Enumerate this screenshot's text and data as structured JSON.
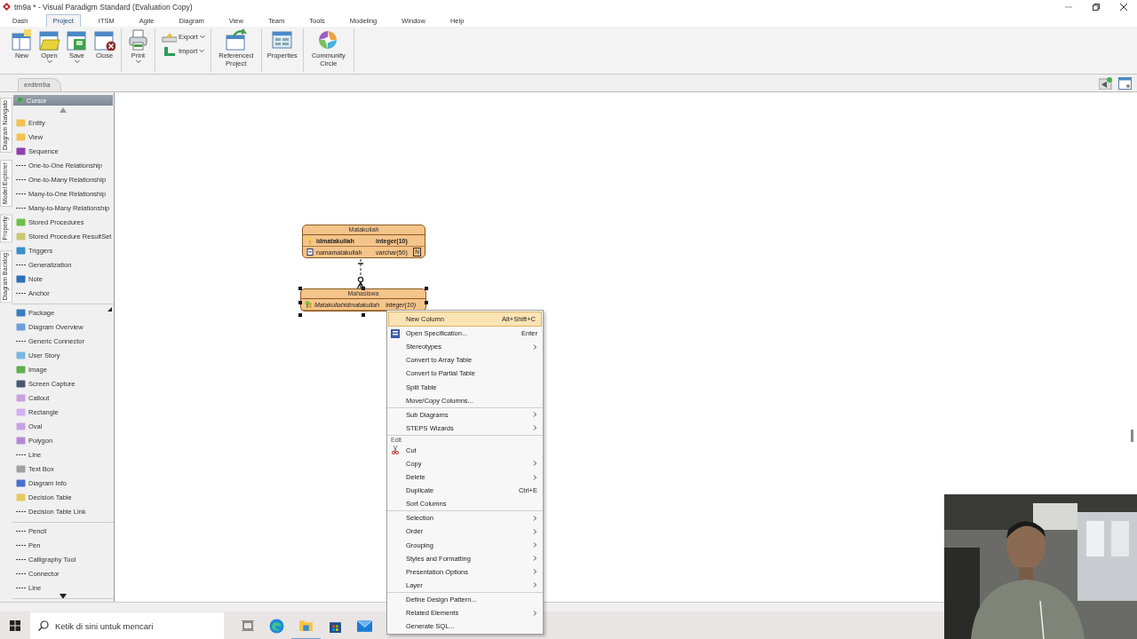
{
  "window": {
    "title": "tm9a * - Visual Paradigm Standard (Evaluation Copy)"
  },
  "menu_tabs": [
    {
      "label": "Dash",
      "selected": false
    },
    {
      "label": "Project",
      "selected": true
    },
    {
      "label": "ITSM",
      "selected": false
    },
    {
      "label": "Agile",
      "selected": false
    },
    {
      "label": "Diagram",
      "selected": false
    },
    {
      "label": "View",
      "selected": false
    },
    {
      "label": "Team",
      "selected": false
    },
    {
      "label": "Tools",
      "selected": false
    },
    {
      "label": "Modeling",
      "selected": false
    },
    {
      "label": "Window",
      "selected": false
    },
    {
      "label": "Help",
      "selected": false
    }
  ],
  "ribbon": [
    {
      "kind": "large",
      "buttons": [
        {
          "label": "New",
          "kind": "new",
          "dropdown": false
        },
        {
          "label": "Open",
          "kind": "open",
          "dropdown": true
        },
        {
          "label": "Save",
          "kind": "save",
          "dropdown": true
        },
        {
          "label": "Close",
          "kind": "close",
          "dropdown": false
        }
      ]
    },
    {
      "kind": "large",
      "buttons": [
        {
          "label": "Print",
          "kind": "print",
          "dropdown": true
        }
      ]
    },
    {
      "kind": "stacked",
      "buttons": [
        {
          "label": "Export",
          "kind": "export",
          "dropdown": true
        },
        {
          "label": "Import",
          "kind": "import",
          "dropdown": true
        }
      ]
    },
    {
      "kind": "large",
      "buttons": [
        {
          "label": "Referenced Project",
          "kind": "referenced",
          "dropdown": false
        }
      ]
    },
    {
      "kind": "large",
      "buttons": [
        {
          "label": "Properties",
          "kind": "properties",
          "dropdown": false
        }
      ]
    },
    {
      "kind": "large",
      "buttons": [
        {
          "label": "Community Circle",
          "kind": "community",
          "dropdown": false
        }
      ]
    }
  ],
  "diagram_tabs": [
    {
      "label": "erdtm9a",
      "selected": true
    }
  ],
  "side_tabs": [
    {
      "label": "Diagram Navigato"
    },
    {
      "label": "Model Explorer"
    },
    {
      "label": "Property"
    },
    {
      "label": "Diagram Backlog"
    }
  ],
  "palette": {
    "cursor": {
      "label": "Cursor",
      "selected": true
    },
    "sections": [
      {
        "items": [
          {
            "label": "Entity",
            "kind": "block",
            "color": "#f2c14e"
          },
          {
            "label": "View",
            "kind": "block",
            "color": "#f2c14e"
          },
          {
            "label": "Sequence",
            "kind": "block",
            "color": "#8e3fb0"
          },
          {
            "label": "One-to-One Relationship",
            "kind": "line"
          },
          {
            "label": "One-to-Many Relationship",
            "kind": "line"
          },
          {
            "label": "Many-to-One Relationship",
            "kind": "line"
          },
          {
            "label": "Many-to-Many Relationship",
            "kind": "line"
          },
          {
            "label": "Stored Procedures",
            "kind": "block",
            "color": "#6cc04a"
          },
          {
            "label": "Stored Procedure ResultSet",
            "kind": "block",
            "color": "#c8c870"
          },
          {
            "label": "Triggers",
            "kind": "block",
            "color": "#3a8fc9"
          },
          {
            "label": "Generalization",
            "kind": "line"
          },
          {
            "label": "Note",
            "kind": "block",
            "color": "#2e6fb5"
          },
          {
            "label": "Anchor",
            "kind": "line"
          }
        ]
      },
      {
        "items": [
          {
            "label": "Package",
            "kind": "block",
            "color": "#3b7bbf"
          },
          {
            "label": "Diagram Overview",
            "kind": "block",
            "color": "#6aa0d8"
          },
          {
            "label": "Generic Connector",
            "kind": "line"
          },
          {
            "label": "User Story",
            "kind": "block",
            "color": "#7ab8e0"
          },
          {
            "label": "Image",
            "kind": "block",
            "color": "#5fae4f"
          },
          {
            "label": "Screen Capture",
            "kind": "block",
            "color": "#4a5a70"
          },
          {
            "label": "Callout",
            "kind": "block",
            "color": "#c9a0e0"
          },
          {
            "label": "Rectangle",
            "kind": "block",
            "color": "#d4b0f0"
          },
          {
            "label": "Oval",
            "kind": "block",
            "color": "#c9a0e0"
          },
          {
            "label": "Polygon",
            "kind": "block",
            "color": "#b48ad8"
          },
          {
            "label": "Line",
            "kind": "line"
          },
          {
            "label": "Text Box",
            "kind": "block",
            "color": "#a0a0a0"
          },
          {
            "label": "Diagram Info",
            "kind": "block",
            "color": "#4a6fd0"
          },
          {
            "label": "Decision Table",
            "kind": "block",
            "color": "#e8c860"
          },
          {
            "label": "Decision Table Link",
            "kind": "line"
          }
        ]
      },
      {
        "items": [
          {
            "label": "Pencil",
            "kind": "line"
          },
          {
            "label": "Pen",
            "kind": "line"
          },
          {
            "label": "Calligraphy Tool",
            "kind": "line"
          },
          {
            "label": "Connector",
            "kind": "line"
          },
          {
            "label": "Line",
            "kind": "line"
          }
        ]
      }
    ]
  },
  "diagram": {
    "entities": [
      {
        "name": "Matakuliah",
        "selected": false,
        "columns": [
          {
            "name": "idmatakuliah",
            "type": "integer(10)",
            "kind": "primary-key"
          },
          {
            "name": "namamatakuliah",
            "type": "varchar(50)",
            "kind": "column",
            "badge": "N"
          }
        ]
      },
      {
        "name": "Mahasiswa",
        "selected": true,
        "columns": [
          {
            "name": "Matakuliahidmatakuliah",
            "type": "integer(10)",
            "kind": "foreign-key"
          }
        ]
      }
    ]
  },
  "context_menu": [
    {
      "items": [
        {
          "label": "New Column",
          "shortcut": "Alt+Shift+C",
          "submenu": false,
          "selected": true,
          "kind": "plain"
        },
        {
          "label": "Open Specification...",
          "shortcut": "Enter",
          "submenu": false,
          "selected": false,
          "kind": "spec"
        },
        {
          "label": "Stereotypes",
          "submenu": true,
          "selected": false,
          "kind": "plain"
        },
        {
          "label": "Convert to Array Table",
          "submenu": false,
          "selected": false,
          "kind": "plain"
        },
        {
          "label": "Convert to Partial Table",
          "submenu": false,
          "selected": false,
          "kind": "plain"
        },
        {
          "label": "Split Table",
          "submenu": false,
          "selected": false,
          "kind": "plain"
        },
        {
          "label": "Move/Copy Columns...",
          "submenu": false,
          "selected": false,
          "kind": "plain"
        }
      ]
    },
    {
      "items": [
        {
          "label": "Sub Diagrams",
          "submenu": true,
          "selected": false,
          "kind": "plain"
        },
        {
          "label": "STEPS Wizards",
          "submenu": true,
          "selected": false,
          "kind": "plain"
        }
      ]
    },
    {
      "heading": "Edit",
      "items": [
        {
          "label": "Cut",
          "submenu": false,
          "selected": false,
          "kind": "cut"
        },
        {
          "label": "Copy",
          "submenu": true,
          "selected": false,
          "kind": "plain"
        },
        {
          "label": "Delete",
          "submenu": true,
          "selected": false,
          "kind": "plain"
        },
        {
          "label": "Duplicate",
          "shortcut": "Ctrl+E",
          "submenu": false,
          "selected": false,
          "kind": "plain"
        },
        {
          "label": "Sort Columns",
          "submenu": false,
          "selected": false,
          "kind": "plain"
        }
      ]
    },
    {
      "items": [
        {
          "label": "Selection",
          "submenu": true,
          "selected": false,
          "kind": "plain"
        },
        {
          "label": "Order",
          "submenu": true,
          "selected": false,
          "kind": "plain"
        },
        {
          "label": "Grouping",
          "submenu": true,
          "selected": false,
          "kind": "plain"
        },
        {
          "label": "Styles and Formatting",
          "submenu": true,
          "selected": false,
          "kind": "plain"
        },
        {
          "label": "Presentation Options",
          "submenu": true,
          "selected": false,
          "kind": "plain"
        },
        {
          "label": "Layer",
          "submenu": true,
          "selected": false,
          "kind": "plain"
        }
      ]
    },
    {
      "items": [
        {
          "label": "Define Design Pattern...",
          "submenu": false,
          "selected": false,
          "kind": "plain"
        },
        {
          "label": "Related Elements",
          "submenu": true,
          "selected": false,
          "kind": "plain"
        },
        {
          "label": "Generate SQL...",
          "submenu": false,
          "selected": false,
          "kind": "plain"
        }
      ]
    }
  ],
  "taskbar": {
    "search": {
      "placeholder": "Ketik di sini untuk mencari"
    },
    "apps": [
      {
        "kind": "task-view",
        "active": false
      },
      {
        "kind": "browser",
        "active": false
      },
      {
        "kind": "folder",
        "active": true
      },
      {
        "kind": "store",
        "active": false
      },
      {
        "kind": "mail",
        "active": false
      }
    ]
  }
}
